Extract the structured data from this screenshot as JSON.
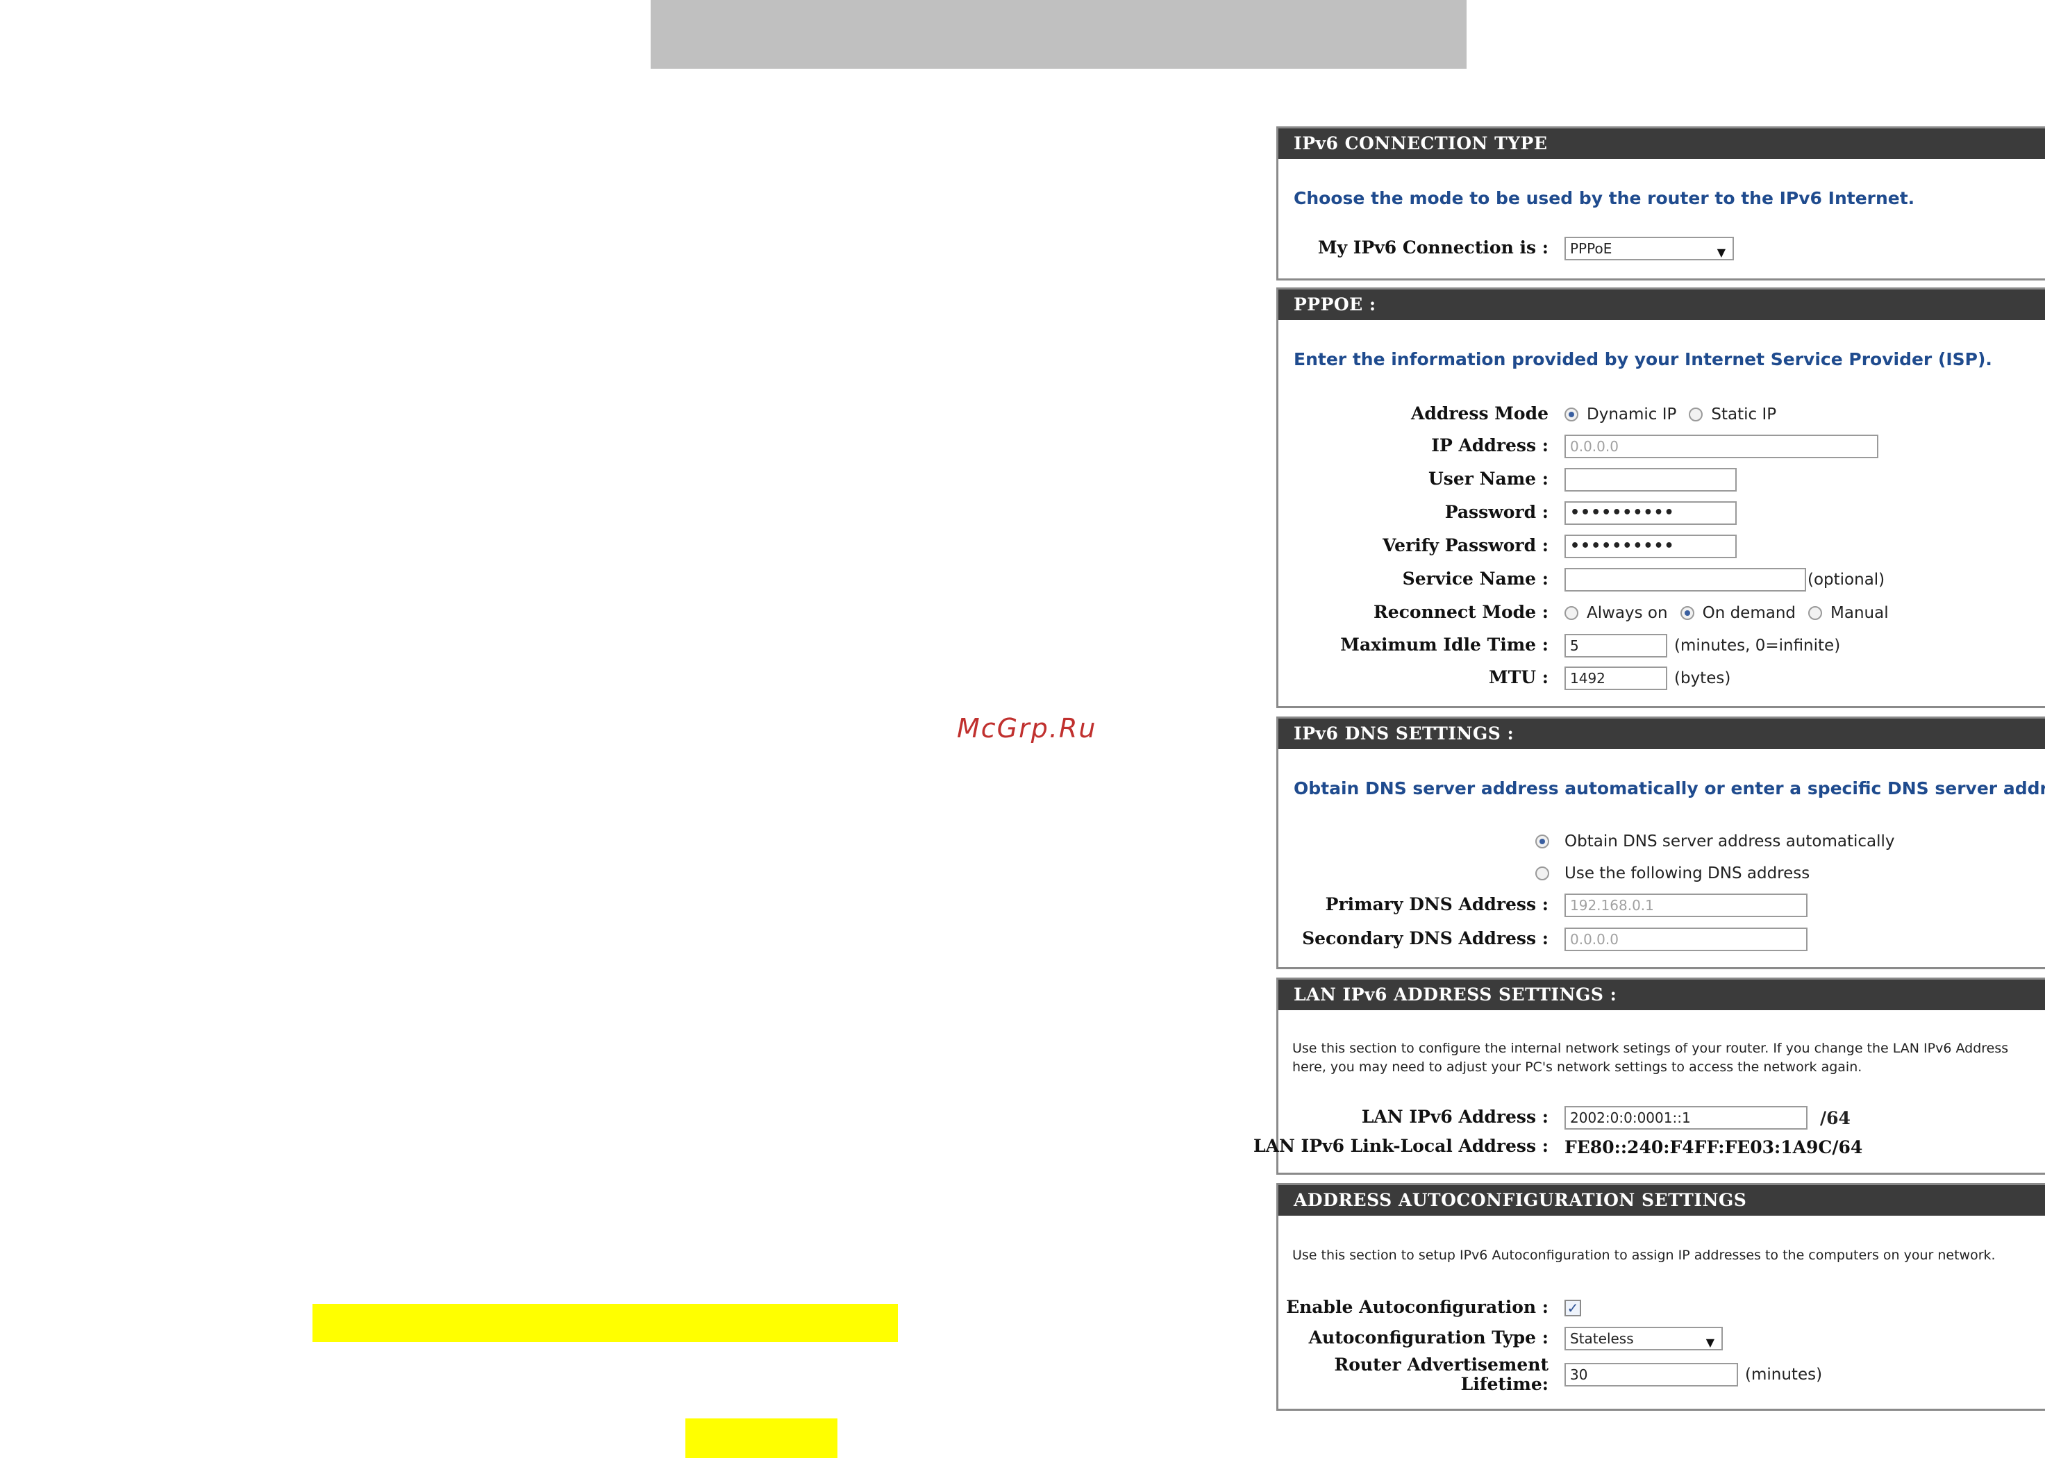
{
  "watermark": "McGrp.Ru",
  "ipv6_connection_type": {
    "header": "IPv6 CONNECTION TYPE",
    "intro": "Choose the mode to be used by the router to the IPv6 Internet.",
    "connection_label": "My IPv6 Connection is :",
    "connection_value": "PPPoE"
  },
  "pppoe": {
    "header": "PPPOE :",
    "intro": "Enter the information provided by your Internet Service Provider (ISP).",
    "address_mode_label": "Address Mode",
    "address_mode_options": [
      "Dynamic IP",
      "Static IP"
    ],
    "address_mode_selected": "Dynamic IP",
    "ip_address_label": "IP Address :",
    "ip_address_value": "0.0.0.0",
    "user_name_label": "User Name :",
    "user_name_value": "",
    "password_label": "Password :",
    "password_value": "••••••••••",
    "verify_password_label": "Verify Password :",
    "verify_password_value": "••••••••••",
    "service_name_label": "Service Name :",
    "service_name_value": "",
    "service_name_suffix": "(optional)",
    "reconnect_mode_label": "Reconnect Mode :",
    "reconnect_options": [
      "Always on",
      "On demand",
      "Manual"
    ],
    "reconnect_selected": "On demand",
    "max_idle_label": "Maximum Idle Time :",
    "max_idle_value": "5",
    "max_idle_suffix": "(minutes, 0=infinite)",
    "mtu_label": "MTU :",
    "mtu_value": "1492",
    "mtu_suffix": "(bytes)"
  },
  "dns": {
    "header": "IPv6 DNS SETTINGS :",
    "intro": "Obtain DNS server address automatically or enter a specific DNS server address.",
    "option_auto": "Obtain DNS server address automatically",
    "option_manual": "Use the following DNS address",
    "selected": "auto",
    "primary_label": "Primary DNS Address :",
    "primary_value": "192.168.0.1",
    "secondary_label": "Secondary DNS Address :",
    "secondary_value": "0.0.0.0"
  },
  "lan": {
    "header": "LAN IPv6 ADDRESS SETTINGS :",
    "intro_line1": "Use this section to configure the internal network setings of your router. If you change the LAN IPv6 Address",
    "intro_line2": "here, you may need to adjust your PC's network settings to access the network again.",
    "lan_address_label": "LAN IPv6 Address :",
    "lan_address_value": "2002:0:0:0001::1",
    "lan_address_suffix": "/64",
    "link_local_label": "LAN IPv6 Link-Local Address :",
    "link_local_value": "FE80::240:F4FF:FE03:1A9C/64"
  },
  "autoconfig": {
    "header": "ADDRESS AUTOCONFIGURATION SETTINGS",
    "intro": "Use this section to setup IPv6 Autoconfiguration to assign IP addresses to the computers on your network.",
    "enable_label": "Enable Autoconfiguration :",
    "enable_checked": true,
    "check_mark": "✓",
    "type_label": "Autoconfiguration Type :",
    "type_value": "Stateless",
    "lifetime_label_line1": "Router Advertisement",
    "lifetime_label_line2": "Lifetime:",
    "lifetime_value": "30",
    "lifetime_suffix": "(minutes)"
  },
  "icons": {
    "dropdown": "chevron-down-icon",
    "caret_glyph": "▼"
  }
}
